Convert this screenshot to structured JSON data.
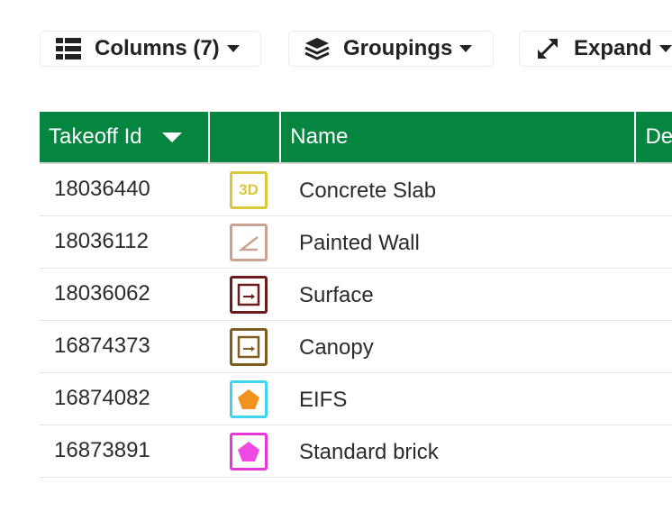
{
  "toolbar": {
    "columns_label": "Columns (7)",
    "groupings_label": "Groupings",
    "expand_label": "Expand"
  },
  "table": {
    "headers": [
      "Takeoff Id",
      "",
      "Name",
      "De"
    ],
    "rows": [
      {
        "id": "18036440",
        "name": "Concrete Slab",
        "icon": "3d-volume-icon",
        "icon_text": "3D",
        "color": "#d9c93a"
      },
      {
        "id": "18036112",
        "name": "Painted Wall",
        "icon": "angle-linear-icon",
        "color": "#c9a293"
      },
      {
        "id": "18036062",
        "name": "Surface",
        "icon": "area-arrow-icon",
        "color": "#6b1d1d"
      },
      {
        "id": "16874373",
        "name": "Canopy",
        "icon": "area-arrow-icon",
        "color": "#7e5e1f"
      },
      {
        "id": "16874082",
        "name": "EIFS",
        "icon": "pentagon-icon",
        "color": "#3fd3ee",
        "fill": "#f2921e"
      },
      {
        "id": "16873891",
        "name": "Standard brick",
        "icon": "pentagon-icon",
        "color": "#e538d9",
        "fill": "#ef48e3"
      }
    ]
  },
  "colors": {
    "header_bg": "#048641",
    "header_text": "#ffffff"
  }
}
